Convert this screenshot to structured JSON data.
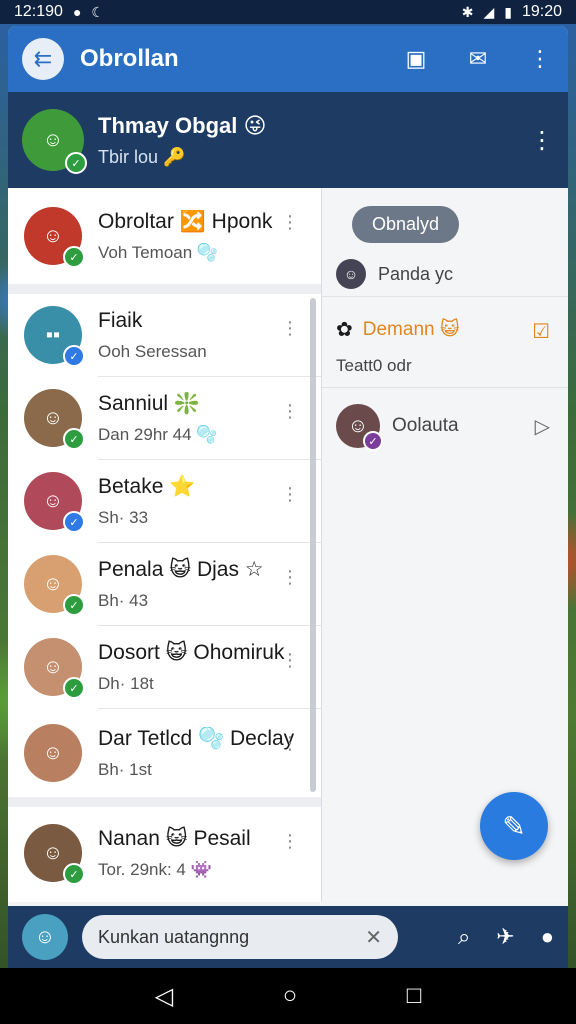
{
  "status": {
    "time_left": "12:190",
    "time_right": "19:20"
  },
  "header": {
    "title": "Obrollan"
  },
  "profile": {
    "name": "Thmay Obgal 😜",
    "status": "Tbir lou 🔑"
  },
  "chats": [
    {
      "name": "Obroltar 🔀 Hponk",
      "sub": "Voh Temoan 🫧",
      "badge": "green",
      "color": "#c0392b"
    },
    {
      "name": "Fiaik",
      "sub": "Ooh Seressan",
      "badge": "blue",
      "color": "#3a8fa8"
    },
    {
      "name": "Sanniul ❇️",
      "sub": "Dan 29hr 44 🫧",
      "badge": "green",
      "color": "#8a6a4a"
    },
    {
      "name": "Betake ⭐",
      "sub": "Sh· 33",
      "badge": "blue",
      "color": "#b04a5a"
    },
    {
      "name": "Penala 😺 Djas ☆",
      "sub": "Bh· 43",
      "badge": "green",
      "color": "#d8a070"
    },
    {
      "name": "Dosort 😺 Ohomiruk",
      "sub": "Dh· 18t",
      "badge": "green",
      "color": "#c49070"
    },
    {
      "name": "Dar Tetlcd 🫧 Declay",
      "sub": "Bh· 1st",
      "badge": "",
      "color": "#b88060"
    },
    {
      "name": "Nanan 😺 Pesail",
      "sub": "Tor. 29nk: 4 👾",
      "badge": "green",
      "color": "#7a5a40"
    }
  ],
  "right_pane": {
    "chip": "Obnalyd",
    "row1": "Panda yc",
    "item2_title": "Demann 😺",
    "item2_sub": "Teatt0 odr",
    "item3_name": "Oolauta"
  },
  "search": {
    "value": "Kunkan uatangnng"
  },
  "colors": {
    "primary": "#2a6fc4",
    "dark": "#1d3b63",
    "accent": "#e0861f"
  }
}
